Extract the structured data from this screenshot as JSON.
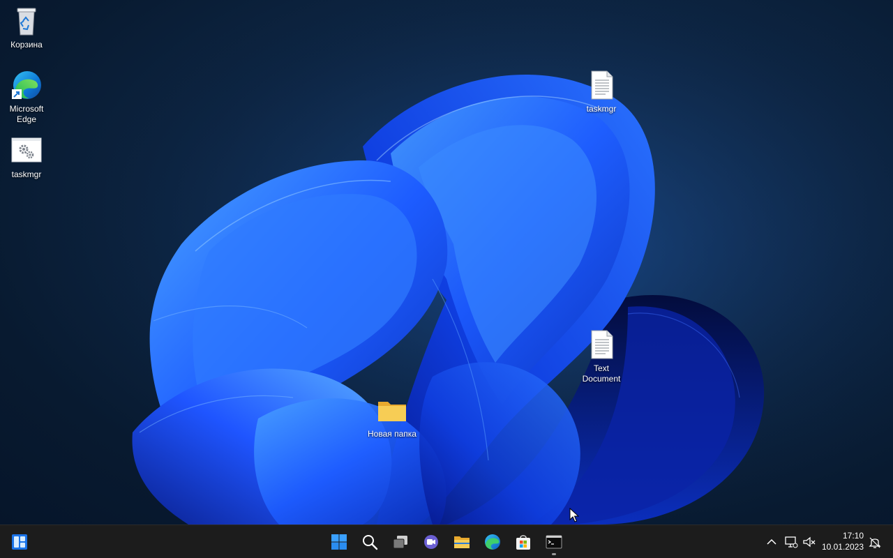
{
  "desktop": {
    "icons": [
      {
        "id": "recycle-bin",
        "label": "Корзина"
      },
      {
        "id": "microsoft-edge",
        "label": "Microsoft Edge"
      },
      {
        "id": "taskmgr-shortcut",
        "label": "taskmgr"
      },
      {
        "id": "taskmgr-file",
        "label": "taskmgr"
      },
      {
        "id": "text-document",
        "label": "Text Document"
      },
      {
        "id": "new-folder",
        "label": "Новая папка"
      }
    ]
  },
  "taskbar": {
    "widgets_icon": "widgets-icon",
    "pinned": [
      {
        "name": "start",
        "icon": "windows-start-icon"
      },
      {
        "name": "search",
        "icon": "search-icon"
      },
      {
        "name": "task-view",
        "icon": "task-view-icon"
      },
      {
        "name": "chat",
        "icon": "teams-chat-icon"
      },
      {
        "name": "file-explorer",
        "icon": "folder-icon"
      },
      {
        "name": "edge",
        "icon": "edge-icon"
      },
      {
        "name": "store",
        "icon": "store-icon"
      },
      {
        "name": "terminal",
        "icon": "terminal-icon"
      }
    ],
    "tray": {
      "time": "17:10",
      "date": "10.01.2023"
    }
  },
  "colors": {
    "taskbar_bg": "#1c1c1c",
    "desktop_bg": "#0d2543",
    "accent": "#1a73ff",
    "folder": "#f4c542"
  }
}
